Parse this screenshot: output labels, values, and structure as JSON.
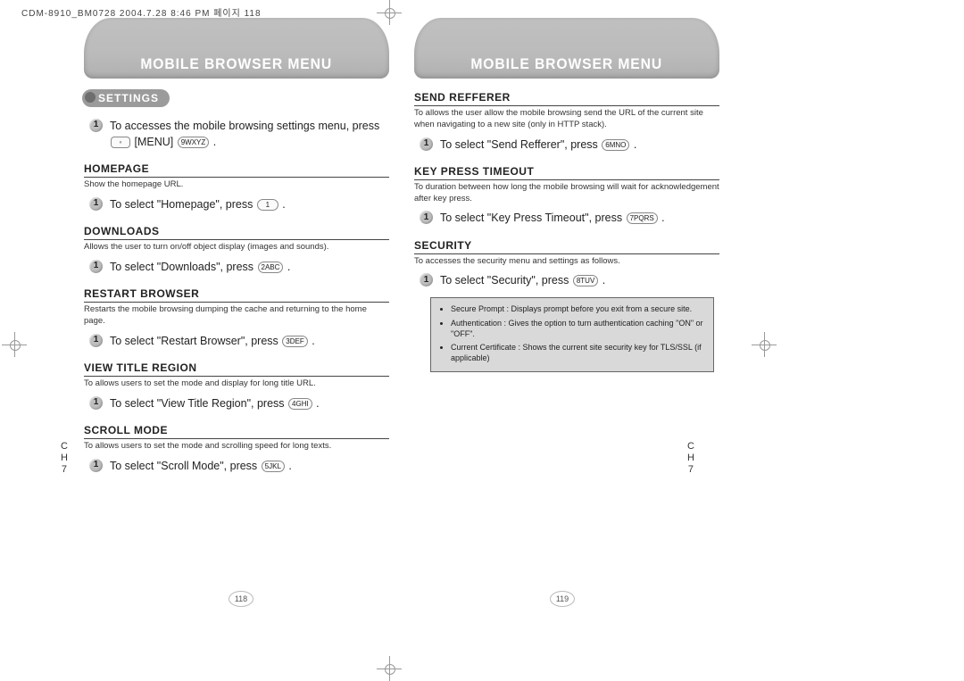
{
  "header": "CDM-8910_BM0728  2004.7.28 8:46 PM  페이지 118",
  "banner": "MOBILE BROWSER MENU",
  "pill_settings": "SETTINGS",
  "chapter": {
    "ch": "C\nH",
    "num": "7"
  },
  "pagenum_left": "118",
  "pagenum_right": "119",
  "left": {
    "intro": {
      "text_a": "To accesses the mobile browsing settings menu, press ",
      "key1": "",
      "text_b": " [MENU] ",
      "key2": "9WXYZ",
      "text_c": " ."
    },
    "homepage": {
      "title": "HOMEPAGE",
      "desc": "Show the homepage URL.",
      "step": {
        "a": "To select \"Homepage\", press ",
        "key": "1",
        "b": " ."
      }
    },
    "downloads": {
      "title": "DOWNLOADS",
      "desc": "Allows the user to turn on/off object display (images and sounds).",
      "step": {
        "a": "To select \"Downloads\", press ",
        "key": "2ABC",
        "b": " ."
      }
    },
    "restart": {
      "title": "RESTART BROWSER",
      "desc": "Restarts the mobile browsing dumping the cache and returning to the home page.",
      "step": {
        "a": "To select \"Restart Browser\", press ",
        "key": "3DEF",
        "b": " ."
      }
    },
    "viewtitle": {
      "title": "VIEW TITLE REGION",
      "desc": "To allows users to set the mode and display for long title URL.",
      "step": {
        "a": "To select \"View Title Region\", press ",
        "key": "4GHI",
        "b": " ."
      }
    },
    "scroll": {
      "title": "SCROLL MODE",
      "desc": "To allows users to set the mode and scrolling speed for long texts.",
      "step": {
        "a": "To select \"Scroll Mode\", press ",
        "key": "5JKL",
        "b": " ."
      }
    }
  },
  "right": {
    "sendref": {
      "title": "SEND REFFERER",
      "desc": "To allows the user allow the mobile browsing send the URL of the current site when navigating to a new site (only in HTTP stack).",
      "step": {
        "a": "To select \"Send Refferer\", press ",
        "key": "6MNO",
        "b": " ."
      }
    },
    "keypress": {
      "title": "KEY PRESS TIMEOUT",
      "desc": "To duration between how long the mobile browsing will wait for acknowledgement after key press.",
      "step": {
        "a": "To select \"Key Press Timeout\", press ",
        "key": "7PQRS",
        "b": " ."
      }
    },
    "security": {
      "title": "SECURITY",
      "desc": "To accesses the security menu and settings as follows.",
      "step": {
        "a": "To select \"Security\", press ",
        "key": "8TUV",
        "b": " ."
      },
      "box": {
        "i1": "Secure Prompt : Displays prompt before you exit from a secure site.",
        "i2": "Authentication : Gives the option to turn authentication caching \"ON\" or \"OFF\".",
        "i3": "Current Certificate : Shows the current site security key for TLS/SSL (if applicable)"
      }
    }
  }
}
